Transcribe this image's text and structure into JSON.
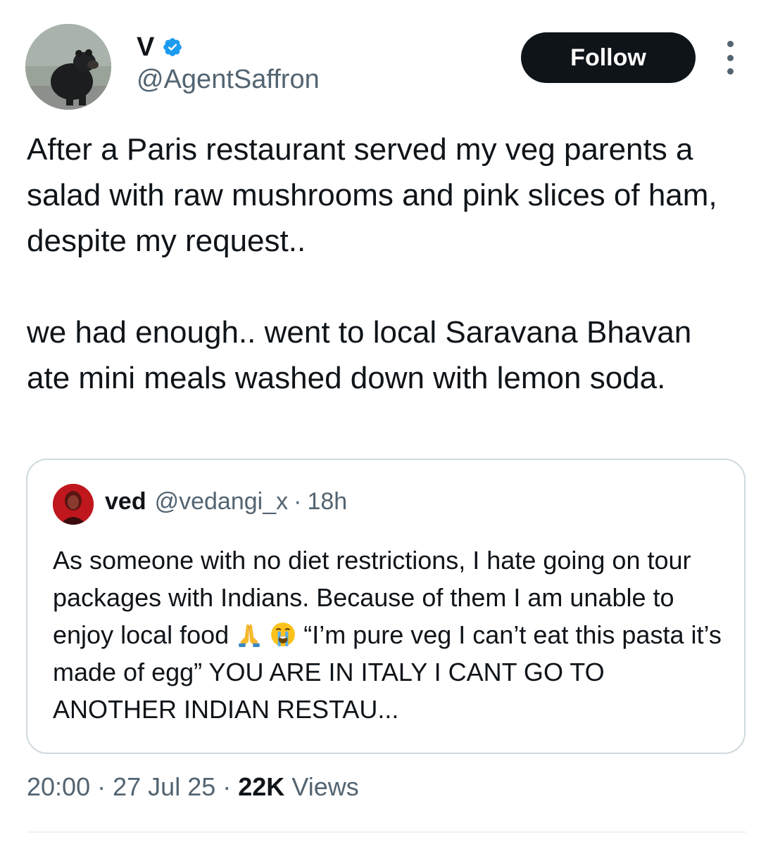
{
  "author": {
    "display_name": "V",
    "handle": "@AgentSaffron",
    "verified": true,
    "avatar_icon": "bear-avatar"
  },
  "follow_label": "Follow",
  "more_icon": "more-options-icon",
  "tweet": {
    "text": "After a Paris restaurant served my veg parents a salad with raw mushrooms and pink slices of ham, despite my request..\n\nwe had enough..  went to local Saravana Bhavan ate mini meals washed down with lemon soda."
  },
  "quote": {
    "name": "ved",
    "handle": "@vedangi_x",
    "separator": "·",
    "time": "18h",
    "text_part1": "As someone with no diet restrictions, I hate going on tour packages with Indians. Because of them I am unable to enjoy local food ",
    "text_part2": " “I’m pure veg I can’t eat this pasta it’s made of egg” YOU ARE IN ITALY I CANT GO TO ANOTHER INDIAN RESTAU...",
    "emojis": [
      "folded-hands-icon",
      "loudly-crying-face-icon"
    ]
  },
  "meta": {
    "time": "20:00",
    "sep1": "·",
    "date": "27 Jul 25",
    "sep2": "·",
    "views_count": "22K",
    "views_label": "Views"
  },
  "colors": {
    "text": "#0f1419",
    "secondary": "#536471",
    "verified": "#1d9bf0",
    "border": "#cfd9de"
  }
}
